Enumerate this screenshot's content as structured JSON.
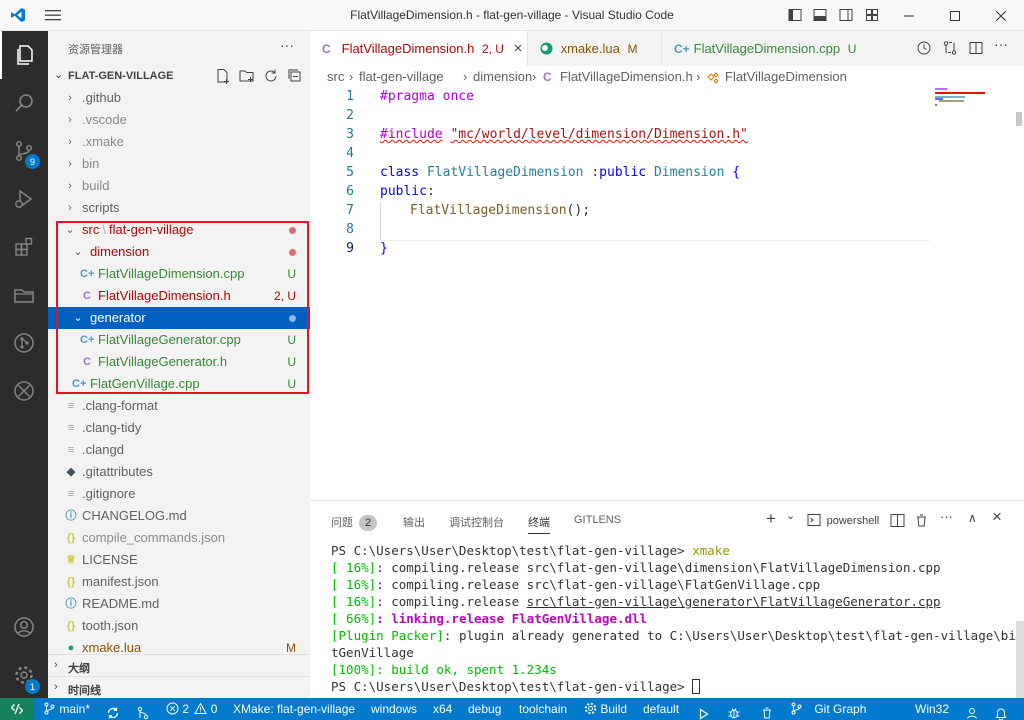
{
  "window": {
    "title": "FlatVillageDimension.h - flat-gen-village - Visual Studio Code"
  },
  "activity_bar": {
    "scm_badge": "9",
    "accounts_badge": "1"
  },
  "sidebar": {
    "header": "资源管理器",
    "more": "···",
    "section_title": "FLAT-GEN-VILLAGE",
    "items": [
      {
        "name": ".github",
        "indent": 0,
        "kind": "folder",
        "collapsed": true,
        "color": "#616161"
      },
      {
        "name": ".vscode",
        "indent": 0,
        "kind": "folder",
        "collapsed": true,
        "color": "#8a8a8a"
      },
      {
        "name": ".xmake",
        "indent": 0,
        "kind": "folder",
        "collapsed": true,
        "color": "#8a8a8a"
      },
      {
        "name": "bin",
        "indent": 0,
        "kind": "folder",
        "collapsed": true,
        "color": "#8a8a8a"
      },
      {
        "name": "build",
        "indent": 0,
        "kind": "folder",
        "collapsed": true,
        "color": "#8a8a8a"
      },
      {
        "name": "scripts",
        "indent": 0,
        "kind": "folder",
        "collapsed": true,
        "color": "#616161"
      },
      {
        "name": "src",
        "name2": "flat-gen-village",
        "indent": 0,
        "kind": "folder",
        "collapsed": false,
        "color": "#ad0707",
        "status": "dot",
        "status_color": "#e06c75"
      },
      {
        "name": "dimension",
        "indent": 1,
        "kind": "folder",
        "collapsed": false,
        "color": "#ad0707",
        "status": "dot",
        "status_color": "#e06c75"
      },
      {
        "name": "FlatVillageDimension.cpp",
        "indent": 2,
        "kind": "cpp",
        "color": "#388a34",
        "status": "U",
        "status_color": "#388a34"
      },
      {
        "name": "FlatVillageDimension.h",
        "indent": 2,
        "kind": "h",
        "color": "#ad0707",
        "status": "2, U",
        "status_color": "#ad0707"
      },
      {
        "name": "generator",
        "indent": 1,
        "kind": "folder",
        "collapsed": false,
        "color": "#ffffff",
        "status": "dot",
        "status_color": "#8fb8e8",
        "selected": true
      },
      {
        "name": "FlatVillageGenerator.cpp",
        "indent": 2,
        "kind": "cpp",
        "color": "#388a34",
        "status": "U",
        "status_color": "#388a34"
      },
      {
        "name": "FlatVillageGenerator.h",
        "indent": 2,
        "kind": "h",
        "color": "#388a34",
        "status": "U",
        "status_color": "#388a34"
      },
      {
        "name": "FlatGenVillage.cpp",
        "indent": 1,
        "kind": "cpp",
        "color": "#388a34",
        "status": "U",
        "status_color": "#388a34"
      },
      {
        "name": ".clang-format",
        "indent": 0,
        "kind": "file",
        "color": "#616161"
      },
      {
        "name": ".clang-tidy",
        "indent": 0,
        "kind": "file",
        "color": "#616161"
      },
      {
        "name": ".clangd",
        "indent": 0,
        "kind": "file",
        "color": "#616161"
      },
      {
        "name": ".gitattributes",
        "indent": 0,
        "kind": "git",
        "color": "#616161"
      },
      {
        "name": ".gitignore",
        "indent": 0,
        "kind": "file",
        "color": "#616161"
      },
      {
        "name": "CHANGELOG.md",
        "indent": 0,
        "kind": "info",
        "color": "#616161"
      },
      {
        "name": "compile_commands.json",
        "indent": 0,
        "kind": "json",
        "color": "#8a8a8a"
      },
      {
        "name": "LICENSE",
        "indent": 0,
        "kind": "license",
        "color": "#616161"
      },
      {
        "name": "manifest.json",
        "indent": 0,
        "kind": "json",
        "color": "#616161"
      },
      {
        "name": "README.md",
        "indent": 0,
        "kind": "info",
        "color": "#616161"
      },
      {
        "name": "tooth.json",
        "indent": 0,
        "kind": "json",
        "color": "#616161"
      },
      {
        "name": "xmake.lua",
        "indent": 0,
        "kind": "lua",
        "color": "#895503",
        "status": "M",
        "status_color": "#895503"
      }
    ],
    "outline": "大纲",
    "timeline": "时间线"
  },
  "tabs": [
    {
      "icon": "C",
      "label": "FlatVillageDimension.h",
      "suffix": "2, U",
      "close": "×",
      "color": "#ad0707",
      "icon_color": "#a074c4"
    },
    {
      "icon": "lua",
      "label": "xmake.lua",
      "suffix": "M",
      "close": "",
      "color": "#895503",
      "icon_color": "#1a9c6a"
    },
    {
      "icon": "C+",
      "label": "FlatVillageDimension.cpp",
      "suffix": "U",
      "close": "",
      "color": "#388a34",
      "icon_color": "#519aba"
    }
  ],
  "breadcrumb": {
    "parts": [
      "src",
      "flat-gen-village",
      "dimension",
      "FlatVillageDimension.h",
      "FlatVillageDimension"
    ],
    "sep": "›"
  },
  "editor": {
    "line_numbers": [
      "1",
      "2",
      "3",
      "4",
      "5",
      "6",
      "7",
      "8",
      "9"
    ],
    "line1": {
      "kw": "#pragma",
      "rest": " once"
    },
    "line3": {
      "kw": "#include",
      "str": "\"mc/world/level/dimension/Dimension.h\""
    },
    "line5": {
      "kw": "class",
      "name": "FlatVillageDimension",
      "mid": " :",
      "kw2": "public",
      "base": "Dimension",
      "brace": " {"
    },
    "line6": {
      "kw": "public",
      "colon": ":"
    },
    "line7": {
      "fn": "FlatVillageDimension",
      "rest": "();"
    },
    "line9": {
      "brace": "}"
    }
  },
  "panel": {
    "tabs": [
      {
        "label": "问题",
        "count": "2"
      },
      {
        "label": "输出"
      },
      {
        "label": "调试控制台"
      },
      {
        "label": "终端"
      },
      {
        "label": "GITLENS"
      }
    ],
    "shell": "powershell",
    "actions": {
      "add": "+",
      "split_caret": "⌄",
      "more": "···",
      "up": "∧",
      "close": "×"
    },
    "terminal": {
      "l1_prompt": "PS C:\\Users\\User\\Desktop\\test\\flat-gen-village> ",
      "l1_cmd": "xmake",
      "l2_pre": "[ 16%]",
      "l2_text": ": compiling.release src\\flat-gen-village\\dimension\\FlatVillageDimension.cpp",
      "l3_pre": "[ 16%]",
      "l3_text": ": compiling.release src\\flat-gen-village\\FlatGenVillage.cpp",
      "l4_pre": "[ 16%]",
      "l4_text": ": compiling.release ",
      "l4_link": "src\\flat-gen-village\\generator\\FlatVillageGenerator.cpp",
      "l5_pre": "[ 66%]",
      "l5_text": ": linking.release FlatGenVillage.dll",
      "l6_pre": "[Plugin Packer]",
      "l6_text": ": plugin already generated to C:\\Users\\User\\Desktop\\test\\flat-gen-village\\bin\\Fla",
      "l7_text": "tGenVillage",
      "l8_pre": "[100%]",
      "l8_text": ": build ok, spent 1.234s",
      "l9_prompt": "PS C:\\Users\\User\\Desktop\\test\\flat-gen-village> "
    }
  },
  "statusbar": {
    "branch": "main*",
    "errors": "2",
    "warnings": "0",
    "xmake": "XMake: flat-gen-village",
    "platform": "windows",
    "arch": "x64",
    "mode": "debug",
    "toolchain": "toolchain",
    "build": "Build",
    "target": "default",
    "gitgraph": "Git Graph",
    "os": "Win32"
  },
  "colors": {
    "accent": "#007acc",
    "selection": "#0060c0",
    "remote": "#16825d",
    "highlight_box": "#e81123"
  }
}
